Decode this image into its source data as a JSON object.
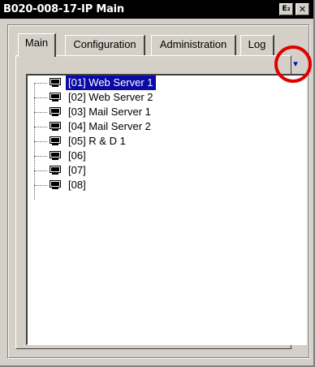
{
  "window": {
    "title": "B020-008-17-IP Main",
    "buttons": {
      "restore_symbol": "E₂",
      "close_symbol": "✕"
    }
  },
  "tabs": [
    {
      "label": "Main",
      "active": true
    },
    {
      "label": "Configuration",
      "active": false
    },
    {
      "label": "Administration",
      "active": false
    },
    {
      "label": "Log",
      "active": false
    }
  ],
  "tree": {
    "expand_button_symbol": "▾",
    "items": [
      {
        "label": "[01] Web Server 1",
        "selected": true
      },
      {
        "label": "[02] Web Server 2",
        "selected": false
      },
      {
        "label": "[03] Mail Server 1",
        "selected": false
      },
      {
        "label": "[04] Mail Server 2",
        "selected": false
      },
      {
        "label": "[05] R & D 1",
        "selected": false
      },
      {
        "label": "[06]",
        "selected": false
      },
      {
        "label": "[07]",
        "selected": false
      },
      {
        "label": "[08]",
        "selected": false
      }
    ]
  },
  "colors": {
    "selection": "#0a0aa6",
    "highlight_circle": "#e00000",
    "window_face": "#d4d0c8"
  }
}
